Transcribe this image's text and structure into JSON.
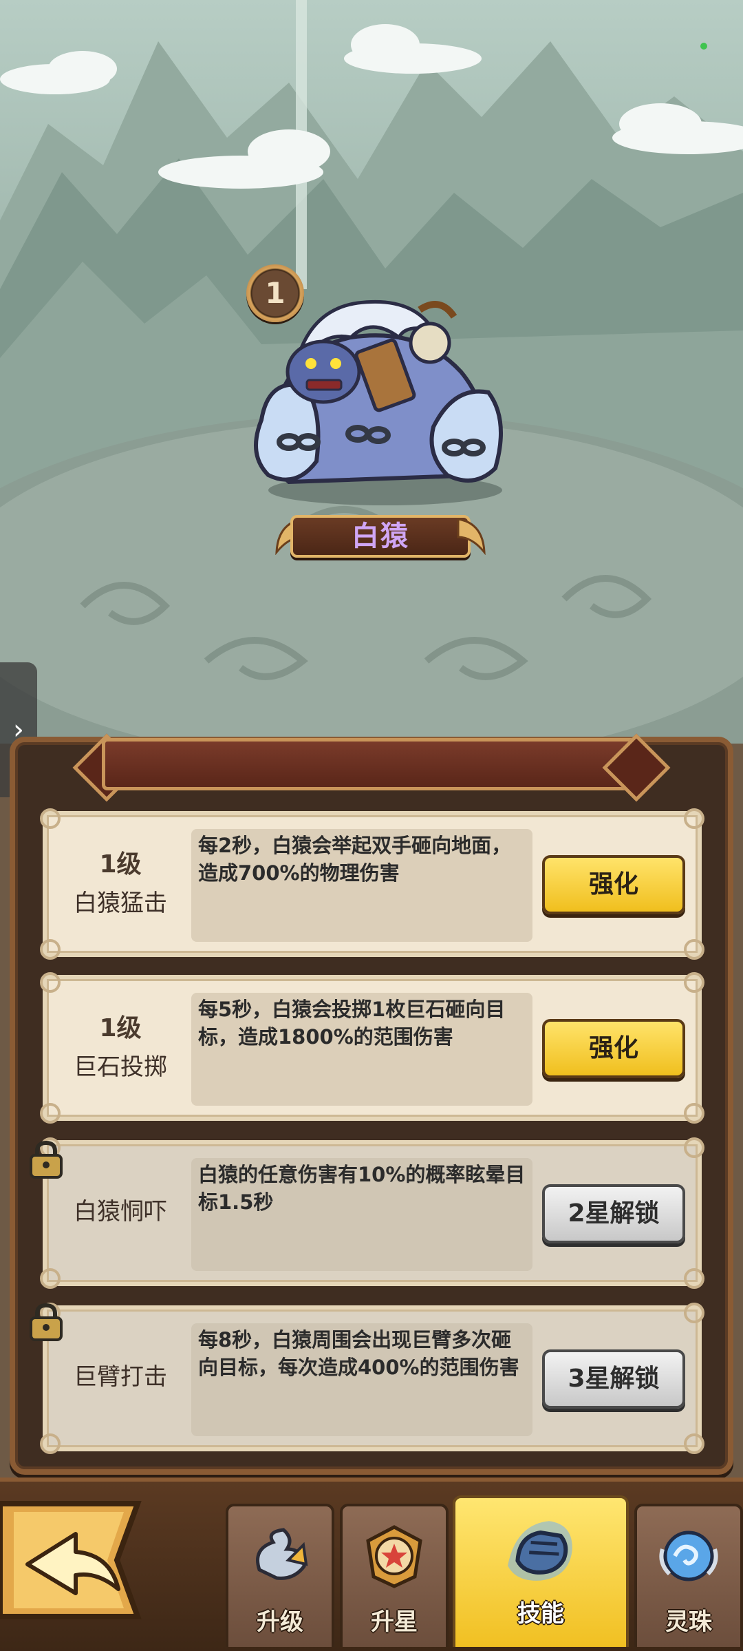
{
  "hero": {
    "level_badge": "1",
    "name": "白猿"
  },
  "skills": [
    {
      "level": "1级",
      "name": "白猿猛击",
      "description": "每2秒，白猿会举起双手砸向地面，造成700%的物理伤害",
      "button": "强化",
      "locked": false
    },
    {
      "level": "1级",
      "name": "巨石投掷",
      "description": "每5秒，白猿会投掷1枚巨石砸向目标，造成1800%的范围伤害",
      "button": "强化",
      "locked": false
    },
    {
      "level": "",
      "name": "白猿恫吓",
      "description": "白猿的任意伤害有10%的概率眩晕目标1.5秒",
      "button": "2星解锁",
      "locked": true
    },
    {
      "level": "",
      "name": "巨臂打击",
      "description": "每8秒，白猿周围会出现巨臂多次砸向目标，每次造成400%的范围伤害",
      "button": "3星解锁",
      "locked": true
    }
  ],
  "side_tab": {
    "icon": "chevron-right-icon",
    "glyph": "›"
  },
  "nav": {
    "back_icon": "back-arrow-icon",
    "tabs": [
      {
        "label": "升级",
        "icon": "dragon-upgrade-icon",
        "active": false
      },
      {
        "label": "升星",
        "icon": "star-medal-icon",
        "active": false
      },
      {
        "label": "技能",
        "icon": "fist-skill-icon",
        "active": true
      },
      {
        "label": "灵珠",
        "icon": "spirit-orb-icon",
        "active": false
      }
    ]
  },
  "colors": {
    "upgrade_button": "#f0bf1e",
    "unlock_button": "#c8c8c8",
    "hero_name": "#d0a6f5",
    "active_tab": "#ffe671"
  }
}
